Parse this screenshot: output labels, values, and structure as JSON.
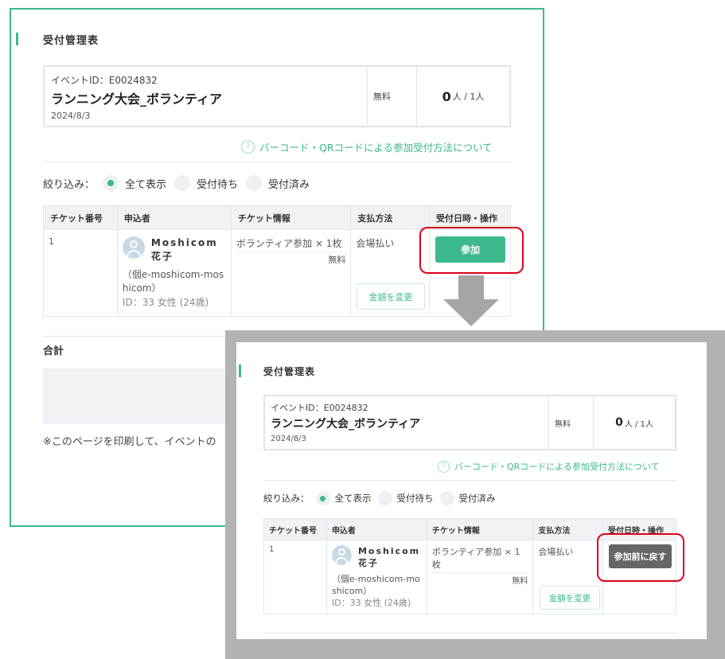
{
  "colors": {
    "accent": "#3cba8c",
    "highlight": "#e0001b",
    "revert_button": "#666666",
    "frame_gray": "#b3b3b3"
  },
  "before": {
    "title": "受付管理表",
    "event": {
      "id_label": "イベントID：E0024832",
      "name": "ランニング大会_ボランティア",
      "date": "2024/8/3",
      "price": "無料",
      "count_big": "0",
      "count_rest": "人 / 1人"
    },
    "help_link": "バーコード・QRコードによる参加受付方法について",
    "filter": {
      "label": "絞り込み：",
      "options": [
        "全て表示",
        "受付待ち",
        "受付済み"
      ],
      "selected": "全て表示"
    },
    "table": {
      "headers": [
        "チケット番号",
        "申込者",
        "チケット情報",
        "支払方法",
        "受付日時・操作"
      ],
      "row": {
        "number": "1",
        "name": "Moshicom 花子",
        "corp": "（個e-moshicom-moshicom）",
        "meta": "ID：33 女性 (24歳)",
        "ticket": "ボランティア参加 × 1枚",
        "ticket_price": "無料",
        "payment": "会場払い",
        "amount_button": "金額を変更",
        "action_button": "参加"
      }
    },
    "total_label": "合計",
    "note": "※このページを印刷して、イベントの"
  },
  "after": {
    "title": "受付管理表",
    "event": {
      "id_label": "イベントID：E0024832",
      "name": "ランニング大会_ボランティア",
      "date": "2024/8/3",
      "price": "無料",
      "count_big": "0",
      "count_rest": "人 / 1人"
    },
    "help_link": "バーコード・QRコードによる参加受付方法について",
    "filter": {
      "label": "絞り込み：",
      "options": [
        "全て表示",
        "受付待ち",
        "受付済み"
      ],
      "selected": "全て表示"
    },
    "table": {
      "headers": [
        "チケット番号",
        "申込者",
        "チケット情報",
        "支払方法",
        "受付日時・操作"
      ],
      "row": {
        "number": "1",
        "name": "Moshicom 花子",
        "corp": "（個e-moshicom-moshicom）",
        "meta": "ID：33 女性 (24歳)",
        "ticket": "ボランティア参加 × 1枚",
        "ticket_price": "無料",
        "payment": "会場払い",
        "amount_button": "金額を変更",
        "action_button": "参加前に戻す"
      }
    }
  }
}
